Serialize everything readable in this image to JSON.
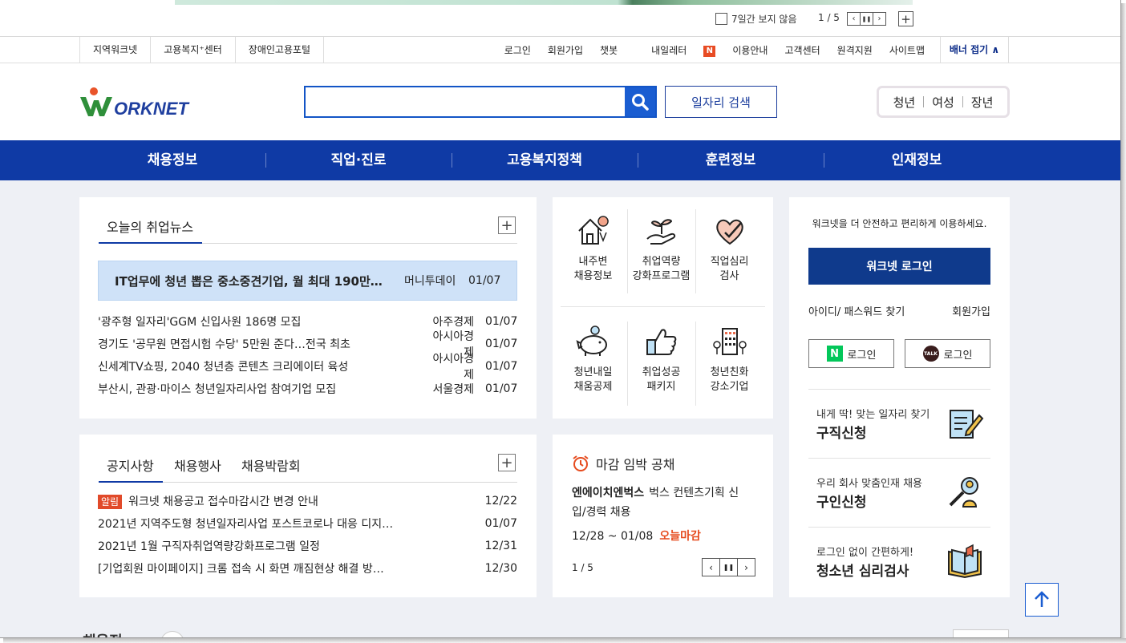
{
  "banner": {
    "hide_label": "7일간 보지 않음",
    "page": "1 / 5",
    "prev": "‹",
    "pause": "❚❚",
    "next": "›",
    "add": "+"
  },
  "util": {
    "left": [
      "지역워크넷",
      "고용복지⁺센터",
      "장애인고용포털"
    ],
    "login": "로그인",
    "signup": "회원가입",
    "chatbot": "챗봇",
    "letter": "내일레터",
    "letter_badge": "N",
    "guide": "이용안내",
    "customer": "고객센터",
    "remote": "원격지원",
    "sitemap": "사이트맵",
    "banner_fold": "배너 접기 ∧"
  },
  "header": {
    "logo_text": "WORKNET",
    "search_placeholder": "",
    "job_search": "일자리 검색",
    "target": [
      "청년",
      "여성",
      "장년"
    ]
  },
  "gnb": [
    "채용정보",
    "직업·진로",
    "고용복지정책",
    "훈련정보",
    "인재정보"
  ],
  "news": {
    "tab": "오늘의 취업뉴스",
    "more": "+",
    "headline": {
      "title": "IT업무에 청년 뽑은 중소중견기업, 월 최대 190만…",
      "source": "머니투데이",
      "date": "01/07"
    },
    "items": [
      {
        "title": "'광주형 일자리'GGM 신입사원 186명 모집",
        "source": "아주경제",
        "date": "01/07"
      },
      {
        "title": "경기도 '공무원 면접시험 수당' 5만원 준다…전국 최초",
        "source": "아시아경제",
        "date": "01/07"
      },
      {
        "title": "신세계TV쇼핑, 2040 청년층 콘텐츠 크리에이터 육성",
        "source": "아시아경제",
        "date": "01/07"
      },
      {
        "title": "부산시, 관광·마이스 청년일자리사업 참여기업 모집",
        "source": "서울경제",
        "date": "01/07"
      }
    ]
  },
  "services": [
    {
      "line1": "내주변",
      "line2": "채용정보"
    },
    {
      "line1": "취업역량",
      "line2": "강화프로그램"
    },
    {
      "line1": "직업심리",
      "line2": "검사"
    },
    {
      "line1": "청년내일",
      "line2": "채움공제"
    },
    {
      "line1": "취업성공",
      "line2": "패키지"
    },
    {
      "line1": "청년친화",
      "line2": "강소기업"
    }
  ],
  "login": {
    "intro": "워크넷을 더 안전하고 편리하게 이용하세요.",
    "button": "워크넷 로그인",
    "find": "아이디/ 패스워드 찾기",
    "join": "회원가입",
    "naver": "로그인",
    "naver_logo": "N",
    "kakao": "로그인",
    "kakao_logo": "TALK"
  },
  "quick": [
    {
      "sub": "내게 딱! 맞는 일자리 찾기",
      "main": "구직신청"
    },
    {
      "sub": "우리 회사 맞춤인재 채용",
      "main": "구인신청"
    },
    {
      "sub": "로그인 없이 간편하게!",
      "main": "청소년 심리검사"
    }
  ],
  "notice": {
    "tabs": [
      "공지사항",
      "채용행사",
      "채용박람회"
    ],
    "more": "+",
    "badge": "알림",
    "items": [
      {
        "title": "워크넷 채용공고 접수마감시간 변경 안내",
        "date": "12/22"
      },
      {
        "title": "2021년 지역주도형 청년일자리사업 포스트코로나 대응 디지…",
        "date": "01/07"
      },
      {
        "title": "2021년 1월 구직자취업역량강화프로그램 일정",
        "date": "12/31"
      },
      {
        "title": "[기업회원 마이페이지] 크롬 접속 시 화면 깨짐현상 해결 방…",
        "date": "12/30"
      }
    ]
  },
  "deadline": {
    "title": "마감 임박 공채",
    "company": "엔에이치엔벅스",
    "job": "벅스 컨텐츠기획 신입/경력 채용",
    "period": "12/28 ~ 01/08",
    "today": "오늘마감",
    "page": "1 / 5",
    "prev": "‹",
    "pause": "❚❚",
    "next": "›"
  },
  "bottom": {
    "title": "채용정"
  },
  "colors": {
    "primary": "#0f3aa5",
    "accent": "#e14a2a",
    "highlight": "#cfe2f8"
  }
}
